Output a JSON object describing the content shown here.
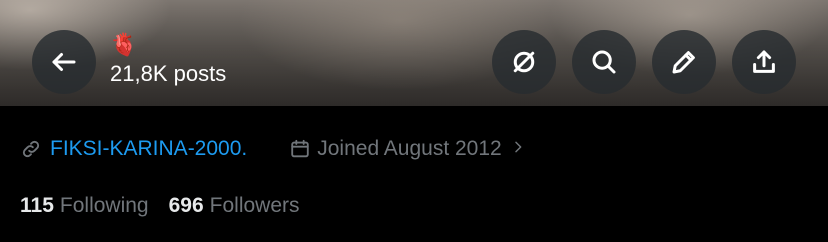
{
  "header": {
    "title_emoji": "🫀",
    "post_count": "21,8K posts"
  },
  "actions": {
    "back": "arrow-left-icon",
    "mute": "mute-icon",
    "search": "search-icon",
    "compose": "pencil-icon",
    "share": "share-icon"
  },
  "profile": {
    "link_text": "FIKSI-KARINA-2000.",
    "joined_text": "Joined August 2012",
    "following_count": "115",
    "following_label": "Following",
    "followers_count": "696",
    "followers_label": "Followers"
  },
  "colors": {
    "link": "#1d9bf0",
    "muted_text": "#71767b",
    "primary_text": "#e7e9ea",
    "background": "#000000"
  }
}
